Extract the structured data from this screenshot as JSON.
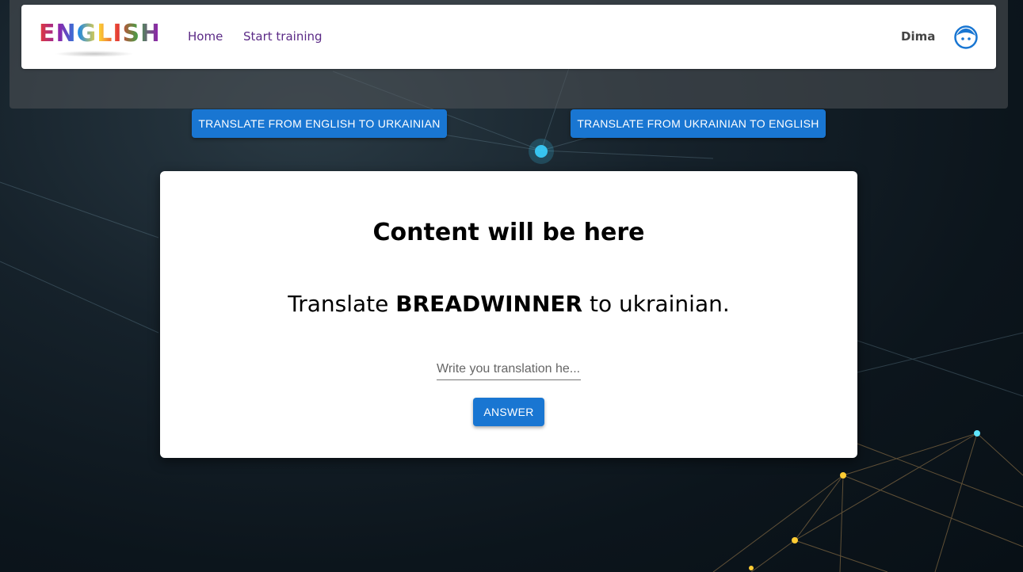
{
  "header": {
    "logo_text": "ENGLISH",
    "nav": [
      {
        "label": "Home"
      },
      {
        "label": "Start training"
      }
    ],
    "user_name": "Dima",
    "avatar_icon": "user-face-icon"
  },
  "modes": {
    "en_to_uk": "TRANSLATE FROM ENGLISH TO URKAINIAN",
    "uk_to_en": "TRANSLATE FROM UKRAINIAN TO ENGLISH"
  },
  "card": {
    "title": "Content will be here",
    "question_prefix": "Translate ",
    "word": "BREADWINNER",
    "question_suffix": " to ukrainian.",
    "input_placeholder": "Write you translation he...",
    "input_value": "",
    "answer_label": "ANSWER"
  },
  "colors": {
    "primary": "#1976d2",
    "nav_link": "#5b2a86",
    "background": "#0c151c"
  }
}
